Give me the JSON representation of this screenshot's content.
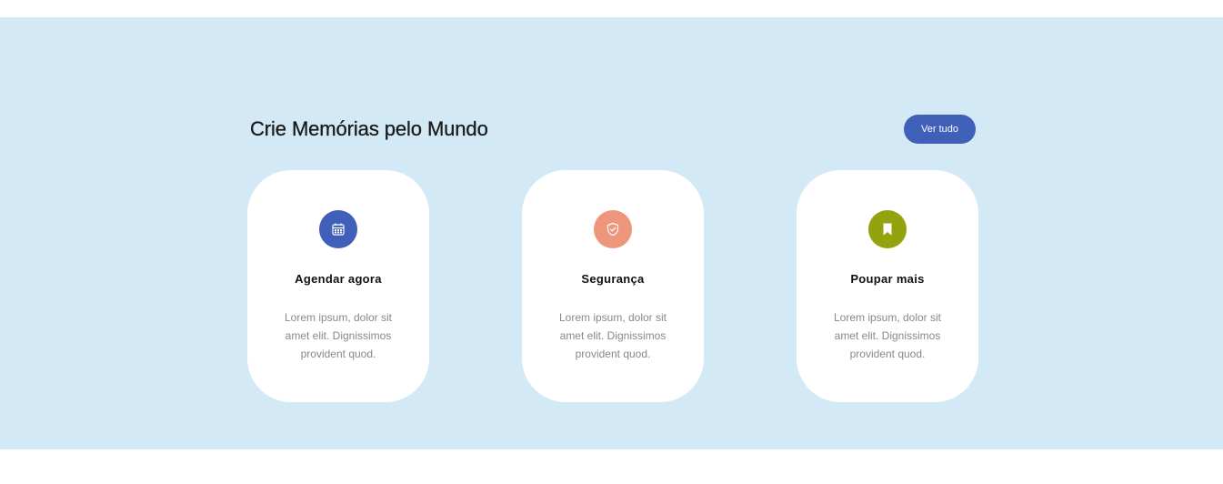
{
  "section": {
    "title": "Crie Memórias pelo Mundo",
    "view_all_label": "Ver tudo"
  },
  "cards": [
    {
      "title": "Agendar agora",
      "text": "Lorem ipsum, dolor sit amet elit. Dignissimos provident quod.",
      "icon": "calendar-icon",
      "color": "#3f5fb8"
    },
    {
      "title": "Segurança",
      "text": "Lorem ipsum, dolor sit amet elit. Dignissimos provident quod.",
      "icon": "shield-check-icon",
      "color": "#ee967b"
    },
    {
      "title": "Poupar mais",
      "text": "Lorem ipsum, dolor sit amet elit. Dignissimos provident quod.",
      "icon": "bookmark-icon",
      "color": "#93a30f"
    }
  ],
  "colors": {
    "section_background": "#d4e9f6",
    "button_background": "#3f5fb8"
  }
}
